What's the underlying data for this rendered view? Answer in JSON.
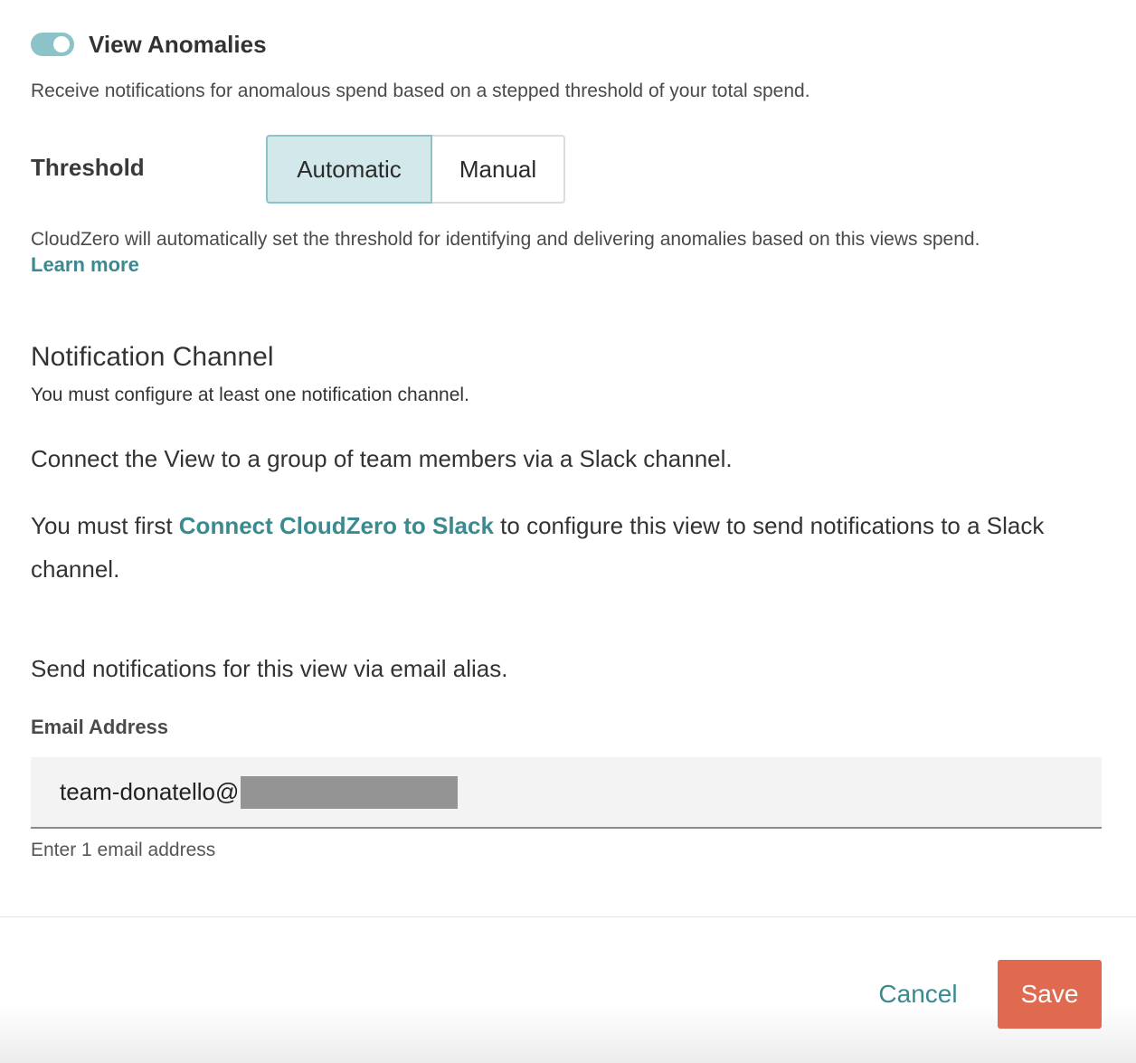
{
  "anomalies": {
    "toggle_on": true,
    "title": "View Anomalies",
    "description": "Receive notifications for anomalous spend based on a stepped threshold of your total spend."
  },
  "threshold": {
    "label": "Threshold",
    "options": [
      "Automatic",
      "Manual"
    ],
    "selected": "Automatic",
    "auto_description": "CloudZero will automatically set the threshold for identifying and delivering anomalies based on this views spend.",
    "learn_more": "Learn more"
  },
  "notification": {
    "title": "Notification Channel",
    "subtitle": "You must configure at least one notification channel.",
    "slack_intro": "Connect the View to a group of team members via a Slack channel.",
    "slack_prefix": "You must first ",
    "slack_link": "Connect CloudZero to Slack",
    "slack_suffix": " to configure this view to send notifications to a Slack channel.",
    "email_intro": "Send notifications for this view via email alias.",
    "email_label": "Email Address",
    "email_value": "team-donatello@",
    "email_helper": "Enter 1 email address"
  },
  "footer": {
    "cancel": "Cancel",
    "save": "Save"
  },
  "colors": {
    "accent": "#3a8a90",
    "toggle": "#8cc3c9",
    "selected_segment": "#d2e8ea",
    "save_button": "#e06a50"
  }
}
